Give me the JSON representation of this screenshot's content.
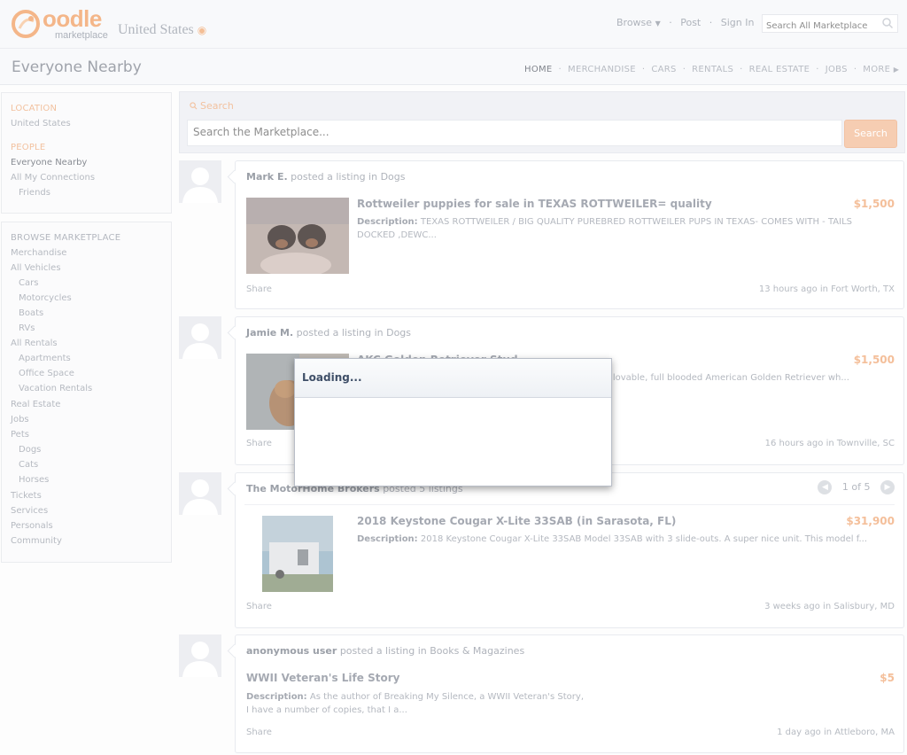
{
  "header": {
    "brand": "oodle",
    "brand_sub": "marketplace",
    "location": "United States",
    "nav": [
      "Browse",
      "Post",
      "Sign In"
    ],
    "search_placeholder": "Search All Marketplace"
  },
  "subheader": {
    "title": "Everyone Nearby",
    "categories": [
      "HOME",
      "MERCHANDISE",
      "CARS",
      "RENTALS",
      "REAL ESTATE",
      "JOBS",
      "MORE"
    ]
  },
  "sidebar": {
    "location_head": "LOCATION",
    "location_value": "United States",
    "people_head": "PEOPLE",
    "people": [
      "Everyone Nearby",
      "All My Connections",
      "Friends"
    ],
    "browse_head": "BROWSE MARKETPLACE",
    "browse": [
      "Merchandise",
      "All Vehicles",
      "Cars",
      "Motorcycles",
      "Boats",
      "RVs",
      "All Rentals",
      "Apartments",
      "Office Space",
      "Vacation Rentals",
      "Real Estate",
      "Jobs",
      "Pets",
      "Dogs",
      "Cats",
      "Horses",
      "Tickets",
      "Services",
      "Personals",
      "Community"
    ]
  },
  "search": {
    "label": "Search",
    "placeholder": "Search the Marketplace...",
    "button": "Search"
  },
  "feed": [
    {
      "poster": "Mark E.",
      "action": "posted a listing in",
      "category": "Dogs",
      "title": "Rottweiler puppies for sale in TEXAS ROTTWEILER= quality",
      "price": "$1,500",
      "desc_label": "Description:",
      "desc": "TEXAS ROTTWEILER / BIG QUALITY PUREBRED ROTTWEILER PUPS IN TEXAS- COMES WITH - TAILS DOCKED ,DEWC...",
      "share": "Share",
      "when": "13 hours ago in Fort Worth, TX"
    },
    {
      "poster": "Jamie M.",
      "action": "posted a listing in",
      "category": "Dogs",
      "title": "AKC Golden Retriever Stud",
      "price": "$1,500",
      "desc_label": "",
      "desc": "nd lovable, full blooded American Golden Retriever wh...",
      "share": "Share",
      "when": "16 hours ago in Townville, SC"
    },
    {
      "poster": "The MotorHome Brokers",
      "action": "posted 5 listings",
      "category": "",
      "pager": "1 of 5",
      "title": "2018 Keystone Cougar X-Lite 33SAB (in Sarasota, FL)",
      "price": "$31,900",
      "desc_label": "Description:",
      "desc": "2018 Keystone Cougar X-Lite 33SAB Model 33SAB with 3 slide-outs. A super nice unit. This model f...",
      "share": "Share",
      "when": "3 weeks ago in Salisbury, MD"
    },
    {
      "poster": "anonymous user",
      "action": "posted a listing in",
      "category": "Books & Magazines",
      "title": "WWII Veteran's Life Story",
      "price": "$5",
      "desc_label": "Description:",
      "desc": "As the author of Breaking My Silence, a WWII Veteran's Story,",
      "desc2": "I have a number of copies, that I a...",
      "share": "Share",
      "when": "1 day ago in Attleboro, MA"
    }
  ],
  "modal": {
    "title": "Loading..."
  },
  "colors": {
    "accent": "#f2a76f",
    "modal_title": "#3f4f68"
  }
}
